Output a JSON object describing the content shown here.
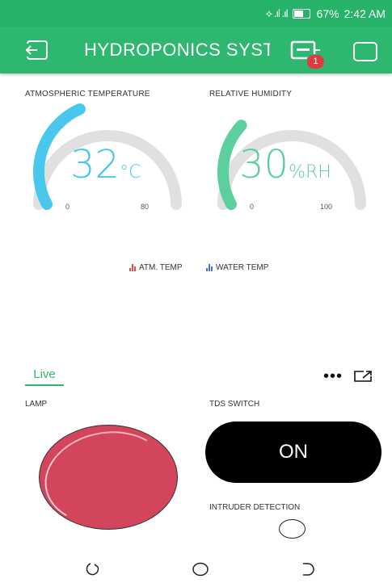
{
  "status_bar": {
    "signal_glyphs": "⟡ .ıl .ıl",
    "battery": "67%",
    "time": "2:42 AM"
  },
  "app_bar": {
    "title": "HYDROPONICS SYST",
    "notification_count": "1",
    "background_color": "#2eb86f"
  },
  "gauges": [
    {
      "label": "ATMOSPHERIC TEMPERATURE",
      "value_text": "32",
      "unit": "°C",
      "value": 32,
      "min_label": "0",
      "max_label": "80",
      "min": 0,
      "max": 80,
      "color": "#4ac7ec"
    },
    {
      "label": "RELATIVE HUMIDITY",
      "value_text": "30",
      "unit": "%RH",
      "value": 30,
      "min_label": "0",
      "max_label": "100",
      "min": 0,
      "max": 100,
      "color": "#5ccf9e"
    }
  ],
  "legend": [
    {
      "label": "ATM. TEMP",
      "color": "#e04b4b"
    },
    {
      "label": "WATER TEMP",
      "color": "#4a6fd6"
    }
  ],
  "tabs": {
    "live": "Live"
  },
  "lamp": {
    "label": "LAMP",
    "color": "#d3455c"
  },
  "tds_switch": {
    "label": "TDS SWITCH",
    "state": "ON"
  },
  "intruder": {
    "label": "INTRUDER DETECTION"
  }
}
